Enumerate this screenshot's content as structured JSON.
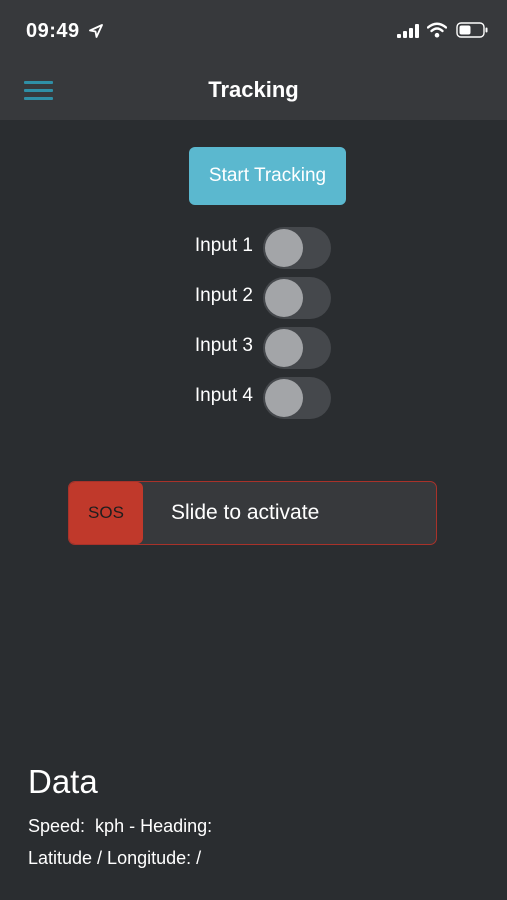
{
  "status_bar": {
    "time": "09:49",
    "icons": [
      "location-arrow-icon",
      "cellular-signal-icon",
      "wifi-icon",
      "battery-icon"
    ]
  },
  "header": {
    "title": "Tracking",
    "menu_icon": "hamburger-menu-icon",
    "accent_color": "#2f8fa6"
  },
  "tracking": {
    "start_label": "Start Tracking",
    "button_color": "#5bb8cf"
  },
  "inputs": [
    {
      "label": "Input 1",
      "on": false
    },
    {
      "label": "Input 2",
      "on": false
    },
    {
      "label": "Input 3",
      "on": false
    },
    {
      "label": "Input 4",
      "on": false
    }
  ],
  "sos": {
    "handle_label": "SOS",
    "slider_text": "Slide to activate",
    "color": "#c0392b"
  },
  "data": {
    "heading": "Data",
    "speed_line": "Speed:  kph - Heading: ",
    "position_line": "Latitude / Longitude: /"
  },
  "theme": {
    "background": "#2a2d30",
    "bar_background": "#37393c"
  }
}
